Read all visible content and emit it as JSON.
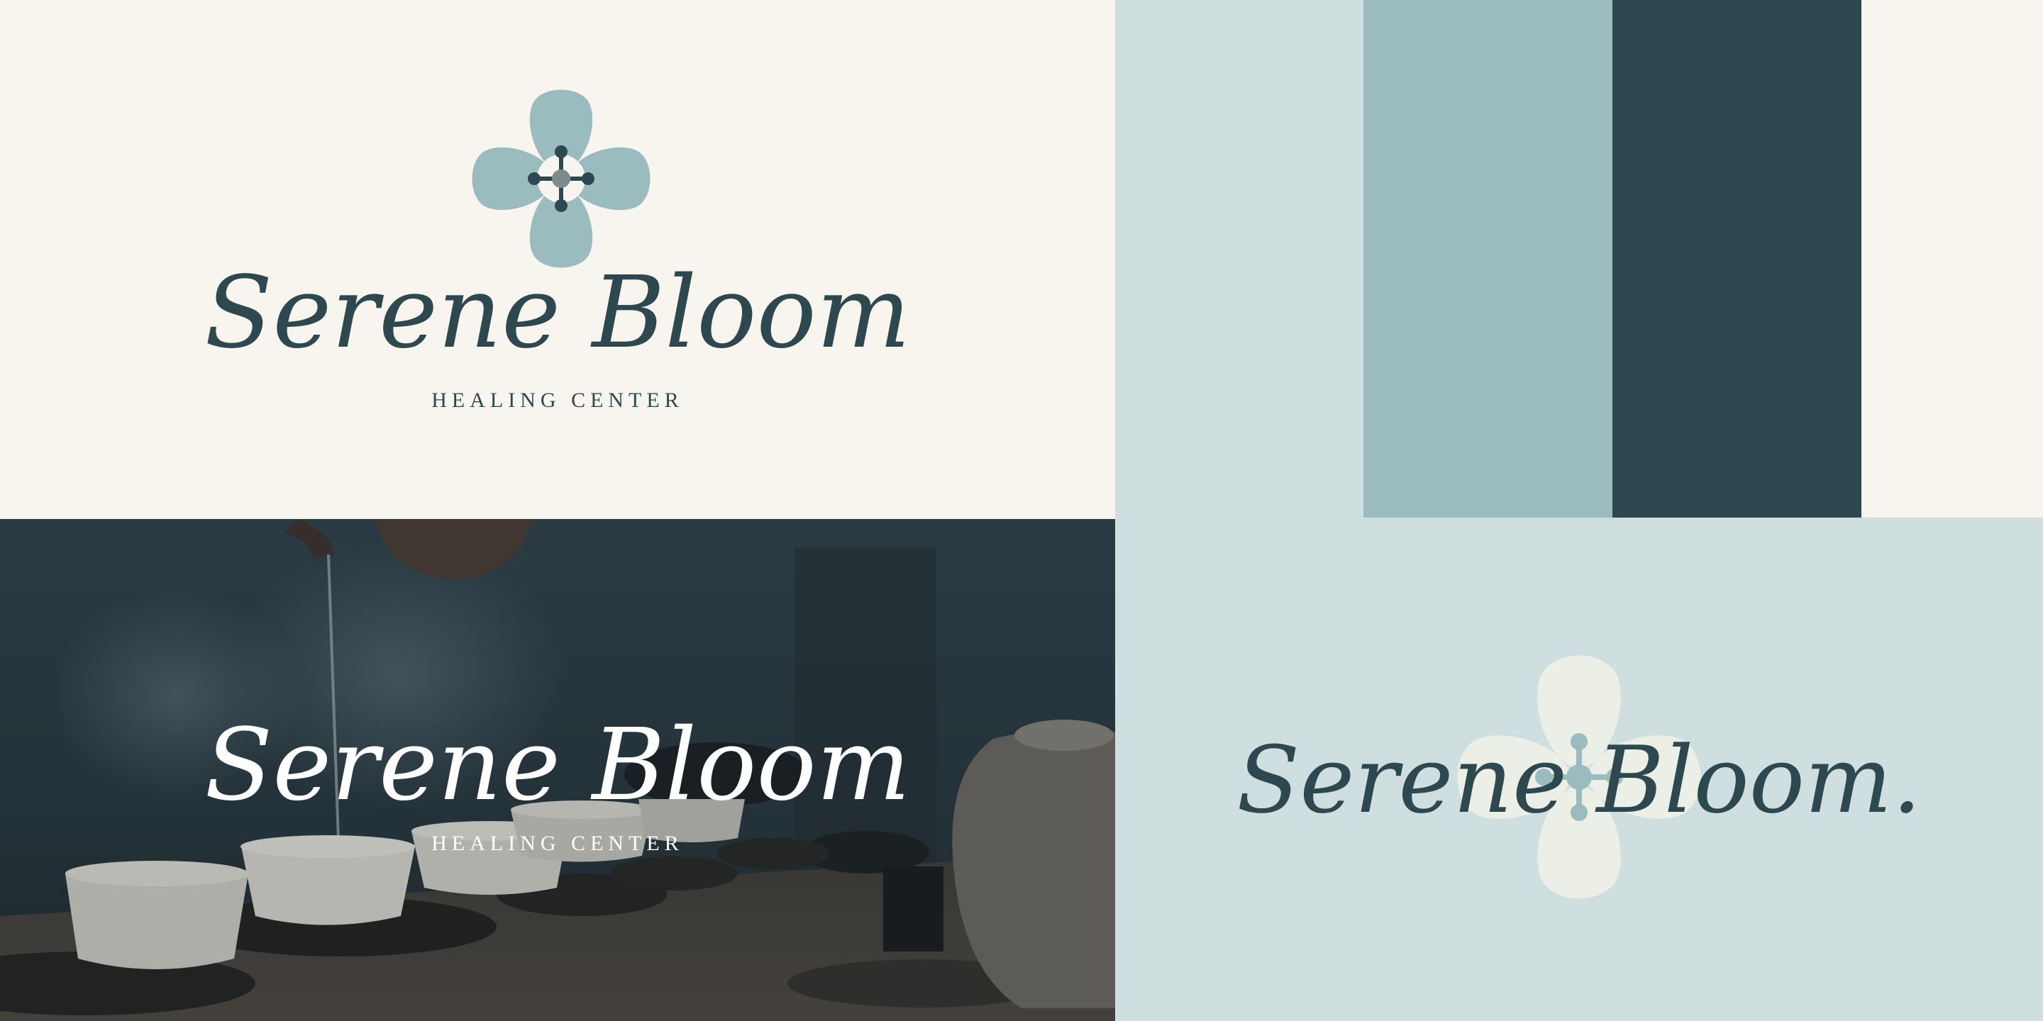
{
  "brand": {
    "name": "Serene Bloom",
    "name_with_period": "Serene Bloom.",
    "tagline": "HEALING CENTER"
  },
  "palette": [
    {
      "name": "cream",
      "hex": "#f8f5ee"
    },
    {
      "name": "mist",
      "hex": "#cfdfe0"
    },
    {
      "name": "sage-blue",
      "hex": "#9abcbf"
    },
    {
      "name": "deep-teal",
      "hex": "#2e4850"
    }
  ],
  "icons": {
    "logo_mark": "four-petal-flower-icon",
    "watermark": "four-petal-flower-watermark-icon"
  },
  "photo": {
    "subject": "tea-pouring-scene",
    "overlay_color": "#1f2c33"
  }
}
